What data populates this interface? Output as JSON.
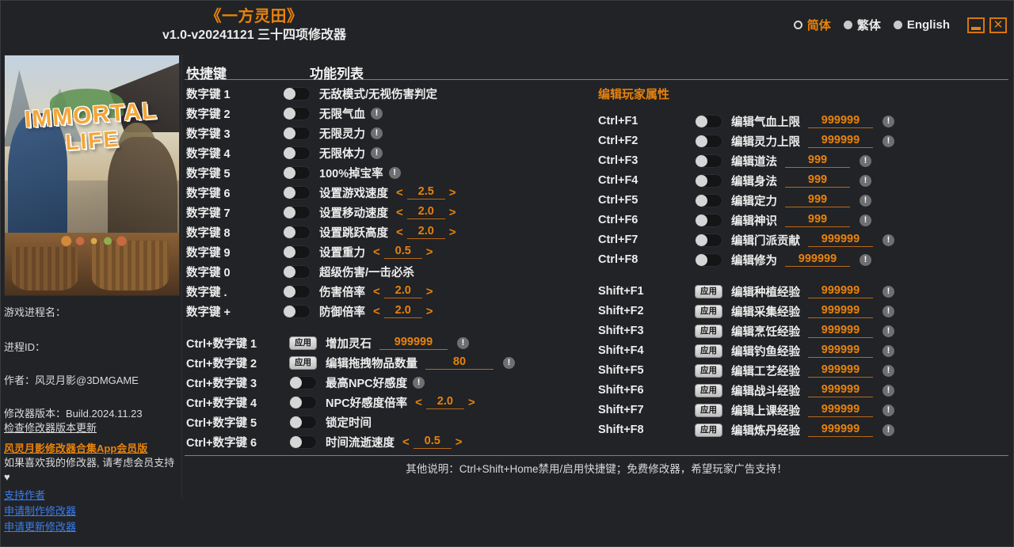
{
  "window": {
    "game_title": "《一方灵田》",
    "version_line": "v1.0-v20241121 三十四项修改器",
    "minimize_label": "",
    "close_label": "✕",
    "accent_color": "#e8820c",
    "background_color": "#212326"
  },
  "languages": [
    {
      "label": "简体",
      "selected": true
    },
    {
      "label": "繁体",
      "selected": false
    },
    {
      "label": "English",
      "selected": false
    }
  ],
  "sidebar": {
    "cover_logo_line1": "IMMORTAL",
    "cover_logo_line2": "LIFE",
    "process_name_label": "游戏进程名：",
    "process_id_label": "进程ID：",
    "author_label": "作者：风灵月影@3DMGAME",
    "trainer_version_label": "修改器版本：Build.2024.11.23",
    "check_update_label": "检查修改器版本更新",
    "vip_app_label": "风灵月影修改器合集App会员版",
    "support_hint_label": "如果喜欢我的修改器, 请考虑会员支持 ♥",
    "links": [
      "支持作者",
      "申请制作修改器",
      "申请更新修改器"
    ]
  },
  "columns": {
    "hotkey_header": "快捷键",
    "function_header": "功能列表",
    "player_attr_header": "编辑玩家属性"
  },
  "apply_button_label": "应用",
  "warn_glyph": "!",
  "arrow_left": "<",
  "arrow_right": ">",
  "main_rows": [
    {
      "hotkey": "数字键 1",
      "control": "toggle",
      "label": "无敌模式/无视伤害判定",
      "warn": false
    },
    {
      "hotkey": "数字键 2",
      "control": "toggle",
      "label": "无限气血",
      "warn": true
    },
    {
      "hotkey": "数字键 3",
      "control": "toggle",
      "label": "无限灵力",
      "warn": true
    },
    {
      "hotkey": "数字键 4",
      "control": "toggle",
      "label": "无限体力",
      "warn": true
    },
    {
      "hotkey": "数字键 5",
      "control": "toggle",
      "label": "100%掉宝率",
      "warn": true
    },
    {
      "hotkey": "数字键 6",
      "control": "toggle",
      "label": "设置游戏速度",
      "stepper": true,
      "value": "2.5"
    },
    {
      "hotkey": "数字键 7",
      "control": "toggle",
      "label": "设置移动速度",
      "stepper": true,
      "value": "2.0"
    },
    {
      "hotkey": "数字键 8",
      "control": "toggle",
      "label": "设置跳跃高度",
      "stepper": true,
      "value": "2.0"
    },
    {
      "hotkey": "数字键 9",
      "control": "toggle",
      "label": "设置重力",
      "stepper": true,
      "value": "0.5"
    },
    {
      "hotkey": "数字键 0",
      "control": "toggle",
      "label": "超级伤害/一击必杀",
      "warn": false
    },
    {
      "hotkey": "数字键 .",
      "control": "toggle",
      "label": "伤害倍率",
      "stepper": true,
      "value": "2.0"
    },
    {
      "hotkey": "数字键 +",
      "control": "toggle",
      "label": "防御倍率",
      "stepper": true,
      "value": "2.0"
    }
  ],
  "ctrl_rows": [
    {
      "hotkey": "Ctrl+数字键 1",
      "control": "apply",
      "label": "增加灵石",
      "field": "999999",
      "warn": true
    },
    {
      "hotkey": "Ctrl+数字键 2",
      "control": "apply",
      "label": "编辑拖拽物品数量",
      "field": "80",
      "warn": true
    },
    {
      "hotkey": "Ctrl+数字键 3",
      "control": "toggle",
      "label": "最高NPC好感度",
      "warn": true
    },
    {
      "hotkey": "Ctrl+数字键 4",
      "control": "toggle",
      "label": "NPC好感度倍率",
      "stepper": true,
      "value": "2.0"
    },
    {
      "hotkey": "Ctrl+数字键 5",
      "control": "toggle",
      "label": "锁定时间",
      "warn": false
    },
    {
      "hotkey": "Ctrl+数字键 6",
      "control": "toggle",
      "label": "时间流逝速度",
      "stepper": true,
      "value": "0.5"
    }
  ],
  "attr_rows": [
    {
      "hotkey": "Ctrl+F1",
      "control": "toggle",
      "label": "编辑气血上限",
      "field": "999999",
      "warn": true
    },
    {
      "hotkey": "Ctrl+F2",
      "control": "toggle",
      "label": "编辑灵力上限",
      "field": "999999",
      "warn": true
    },
    {
      "hotkey": "Ctrl+F3",
      "control": "toggle",
      "label": "编辑道法",
      "field": "999",
      "warn": true
    },
    {
      "hotkey": "Ctrl+F4",
      "control": "toggle",
      "label": "编辑身法",
      "field": "999",
      "warn": true
    },
    {
      "hotkey": "Ctrl+F5",
      "control": "toggle",
      "label": "编辑定力",
      "field": "999",
      "warn": true
    },
    {
      "hotkey": "Ctrl+F6",
      "control": "toggle",
      "label": "编辑神识",
      "field": "999",
      "warn": true
    },
    {
      "hotkey": "Ctrl+F7",
      "control": "toggle",
      "label": "编辑门派贡献",
      "field": "999999",
      "warn": true
    },
    {
      "hotkey": "Ctrl+F8",
      "control": "toggle",
      "label": "编辑修为",
      "field": "999999",
      "warn": true
    }
  ],
  "exp_rows": [
    {
      "hotkey": "Shift+F1",
      "control": "apply",
      "label": "编辑种植经验",
      "field": "999999",
      "warn": true
    },
    {
      "hotkey": "Shift+F2",
      "control": "apply",
      "label": "编辑采集经验",
      "field": "999999",
      "warn": true
    },
    {
      "hotkey": "Shift+F3",
      "control": "apply",
      "label": "编辑烹饪经验",
      "field": "999999",
      "warn": true
    },
    {
      "hotkey": "Shift+F4",
      "control": "apply",
      "label": "编辑钓鱼经验",
      "field": "999999",
      "warn": true
    },
    {
      "hotkey": "Shift+F5",
      "control": "apply",
      "label": "编辑工艺经验",
      "field": "999999",
      "warn": true
    },
    {
      "hotkey": "Shift+F6",
      "control": "apply",
      "label": "编辑战斗经验",
      "field": "999999",
      "warn": true
    },
    {
      "hotkey": "Shift+F7",
      "control": "apply",
      "label": "编辑上课经验",
      "field": "999999",
      "warn": true
    },
    {
      "hotkey": "Shift+F8",
      "control": "apply",
      "label": "编辑炼丹经验",
      "field": "999999",
      "warn": true
    }
  ],
  "footer": {
    "note": "其他说明：Ctrl+Shift+Home禁用/启用快捷键；免费修改器，希望玩家广告支持！"
  }
}
